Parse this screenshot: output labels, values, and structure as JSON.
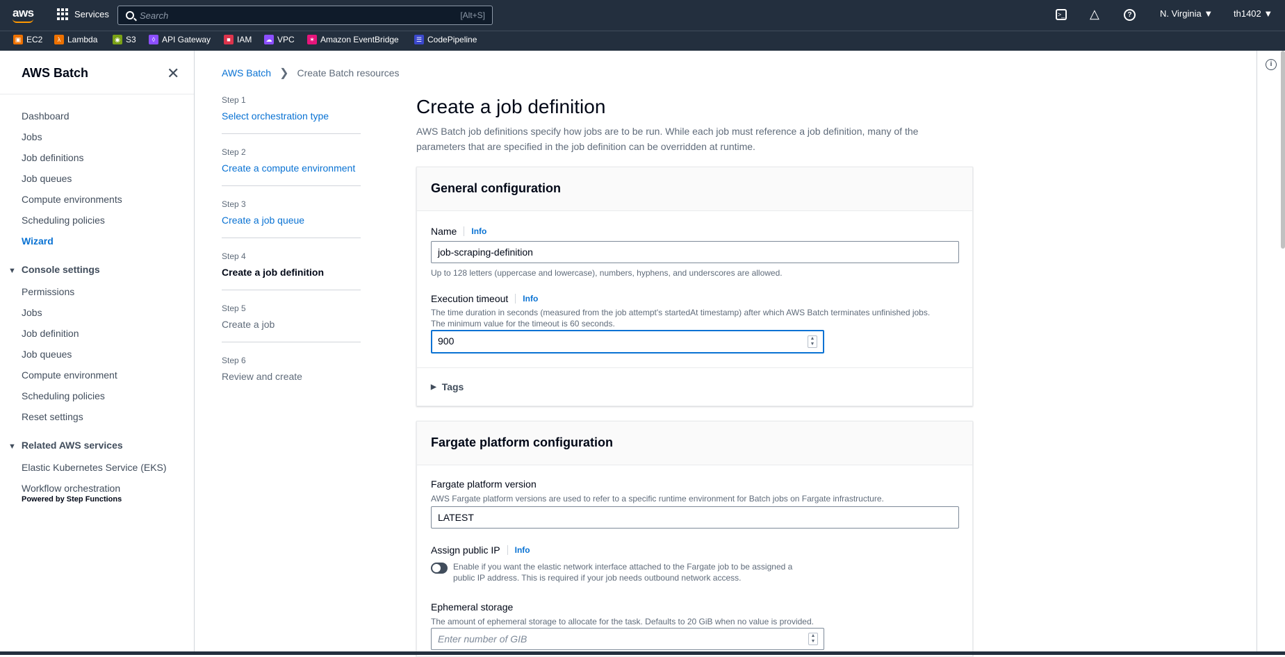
{
  "topbar": {
    "logo": "aws",
    "services_label": "Services",
    "search_placeholder": "Search",
    "search_shortcut": "[Alt+S]",
    "region": "N. Virginia ▼",
    "user": "th1402 ▼"
  },
  "favorites": [
    {
      "label": "EC2",
      "color": "#ed7100",
      "icon": "ec2-icon"
    },
    {
      "label": "Lambda",
      "color": "#ed7100",
      "icon": "lambda-icon"
    },
    {
      "label": "S3",
      "color": "#7aa116",
      "icon": "s3-icon"
    },
    {
      "label": "API Gateway",
      "color": "#8c4fff",
      "icon": "api-gateway-icon"
    },
    {
      "label": "IAM",
      "color": "#dd344c",
      "icon": "iam-icon"
    },
    {
      "label": "VPC",
      "color": "#8c4fff",
      "icon": "vpc-icon"
    },
    {
      "label": "Amazon EventBridge",
      "color": "#e7157b",
      "icon": "eventbridge-icon"
    },
    {
      "label": "CodePipeline",
      "color": "#3b48cc",
      "icon": "codepipeline-icon"
    }
  ],
  "sidenav": {
    "title": "AWS Batch",
    "items": [
      "Dashboard",
      "Jobs",
      "Job definitions",
      "Job queues",
      "Compute environments",
      "Scheduling policies",
      "Wizard"
    ],
    "console_settings": {
      "title": "Console settings",
      "items": [
        "Permissions",
        "Jobs",
        "Job definition",
        "Job queues",
        "Compute environment",
        "Scheduling policies",
        "Reset settings"
      ]
    },
    "related": {
      "title": "Related AWS services",
      "items": [
        "Elastic Kubernetes Service (EKS)",
        "Workflow orchestration"
      ],
      "sub": "Powered by Step Functions"
    }
  },
  "breadcrumb": {
    "root": "AWS Batch",
    "current": "Create Batch resources"
  },
  "steps": [
    {
      "label": "Step 1",
      "title": "Select orchestration type",
      "state": "link"
    },
    {
      "label": "Step 2",
      "title": "Create a compute environment",
      "state": "link"
    },
    {
      "label": "Step 3",
      "title": "Create a job queue",
      "state": "link"
    },
    {
      "label": "Step 4",
      "title": "Create a job definition",
      "state": "current"
    },
    {
      "label": "Step 5",
      "title": "Create a job",
      "state": "disabled"
    },
    {
      "label": "Step 6",
      "title": "Review and create",
      "state": "disabled"
    }
  ],
  "main": {
    "title": "Create a job definition",
    "description": "AWS Batch job definitions specify how jobs are to be run. While each job must reference a job definition, many of the parameters that are specified in the job definition can be overridden at runtime."
  },
  "general": {
    "heading": "General configuration",
    "name_label": "Name",
    "info": "Info",
    "name_value": "job-scraping-definition",
    "name_hint": "Up to 128 letters (uppercase and lowercase), numbers, hyphens, and underscores are allowed.",
    "timeout_label": "Execution timeout",
    "timeout_desc_1": "The time duration in seconds (measured from the job attempt's startedAt timestamp) after which AWS Batch terminates unfinished jobs.",
    "timeout_desc_2": "The minimum value for the timeout is 60 seconds.",
    "timeout_value": "900",
    "tags_label": "Tags"
  },
  "fargate": {
    "heading": "Fargate platform configuration",
    "version_label": "Fargate platform version",
    "version_desc": "AWS Fargate platform versions are used to refer to a specific runtime environment for Batch jobs on Fargate infrastructure.",
    "version_value": "LATEST",
    "public_ip_label": "Assign public IP",
    "public_ip_desc_1": "Enable if you want the elastic network interface attached to the Fargate job to be assigned a",
    "public_ip_desc_2": "public IP address. This is required if your job needs outbound network access.",
    "public_ip_enabled": false,
    "storage_label": "Ephemeral storage",
    "storage_desc": "The amount of ephemeral storage to allocate for the task. Defaults to 20 GiB when no value is provided.",
    "storage_placeholder": "Enter number of GIB"
  }
}
